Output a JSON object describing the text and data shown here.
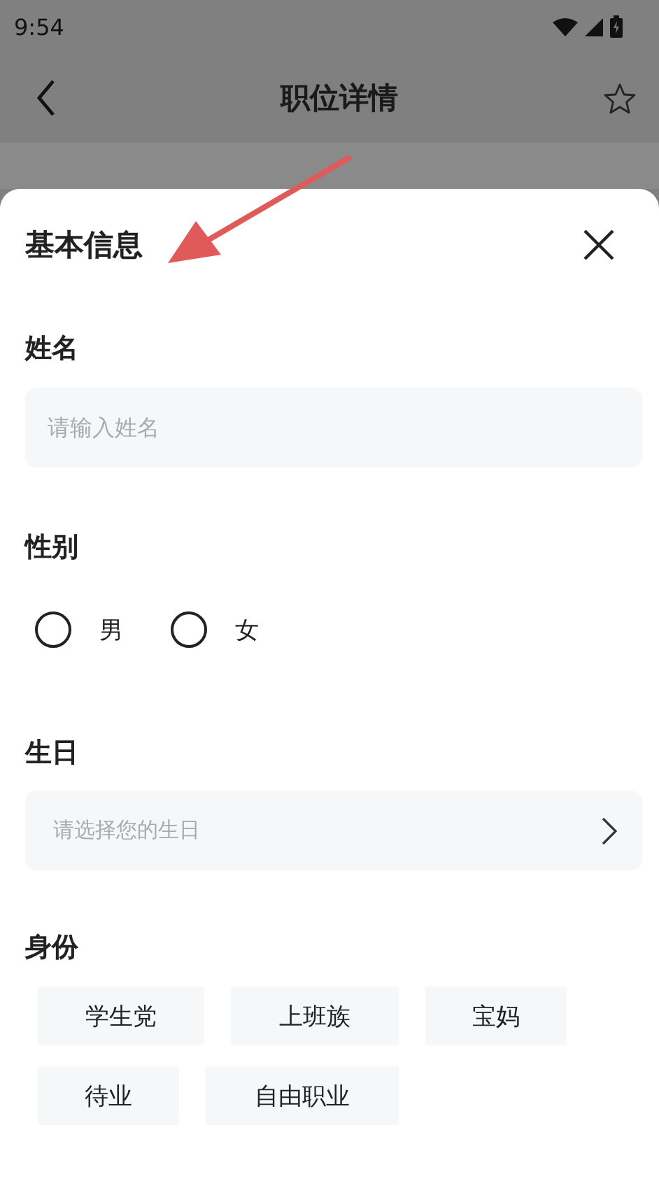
{
  "status_bar": {
    "time": "9:54"
  },
  "header": {
    "title": "职位详情"
  },
  "sheet": {
    "title": "基本信息",
    "name_field": {
      "label": "姓名",
      "placeholder": "请输入姓名"
    },
    "gender": {
      "label": "性别",
      "options": [
        {
          "label": "男",
          "selected": false
        },
        {
          "label": "女",
          "selected": false
        }
      ]
    },
    "birthday": {
      "label": "生日",
      "placeholder": "请选择您的生日"
    },
    "identity": {
      "label": "身份",
      "options": [
        {
          "label": "学生党",
          "selected": false
        },
        {
          "label": "上班族",
          "selected": false
        },
        {
          "label": "宝妈",
          "selected": false
        },
        {
          "label": "待业",
          "selected": false
        },
        {
          "label": "自由职业",
          "selected": false
        }
      ]
    }
  }
}
